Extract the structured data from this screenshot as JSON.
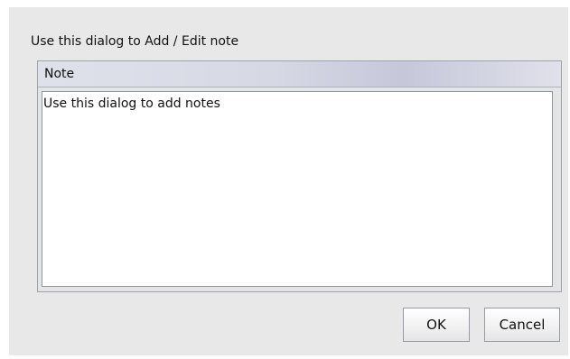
{
  "dialog": {
    "instructions": "Use this dialog to Add / Edit note",
    "note_panel": {
      "header": "Note",
      "text": "Use this dialog to add notes"
    },
    "buttons": {
      "ok": "OK",
      "cancel": "Cancel"
    }
  },
  "colors": {
    "dialog_background": "#e8e8e8",
    "header_gradient_start": "#dfe1ea",
    "header_gradient_mid": "#c6c7da",
    "text": "#111111"
  }
}
